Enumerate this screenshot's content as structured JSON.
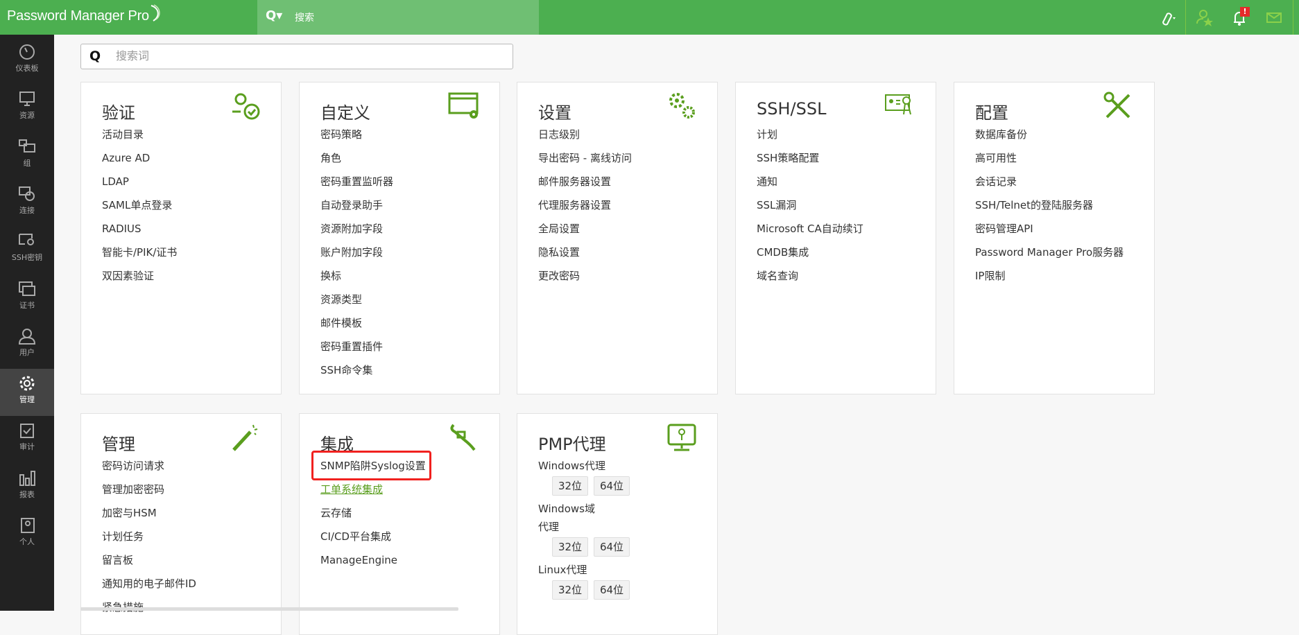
{
  "app": {
    "logo": "Password Manager Pro",
    "global_search": "搜索"
  },
  "colors": {
    "brand": "#4caf50",
    "accent": "#5a9e1e",
    "highlight": "#f0211f"
  },
  "topbar": {
    "badge": "!"
  },
  "sidebar": [
    {
      "label": "仪表板",
      "icon": "dashboard-icon"
    },
    {
      "label": "资源",
      "icon": "monitor-icon"
    },
    {
      "label": "组",
      "icon": "group-icon"
    },
    {
      "label": "连接",
      "icon": "connection-icon"
    },
    {
      "label": "SSH密钥",
      "icon": "ssh-key-icon"
    },
    {
      "label": "证书",
      "icon": "certificate-icon"
    },
    {
      "label": "用户",
      "icon": "user-icon"
    },
    {
      "label": "管理",
      "icon": "gear-icon",
      "active": true
    },
    {
      "label": "审计",
      "icon": "audit-icon"
    },
    {
      "label": "报表",
      "icon": "report-icon"
    },
    {
      "label": "个人",
      "icon": "personal-icon"
    }
  ],
  "search": {
    "placeholder": "搜索词",
    "value": ""
  },
  "cards": [
    {
      "title": "验证",
      "items": [
        "活动目录",
        "Azure AD",
        "LDAP",
        "SAML单点登录",
        "RADIUS",
        "智能卡/PIK/证书",
        "双因素验证"
      ]
    },
    {
      "title": "自定义",
      "items": [
        "密码策略",
        "角色",
        "密码重置监听器",
        "自动登录助手",
        "资源附加字段",
        "账户附加字段",
        "换标",
        "资源类型",
        "邮件模板",
        "密码重置插件",
        "SSH命令集"
      ]
    },
    {
      "title": "设置",
      "items": [
        "日志级别",
        "导出密码 - 离线访问",
        "邮件服务器设置",
        "代理服务器设置",
        "全局设置",
        "隐私设置",
        "更改密码"
      ]
    },
    {
      "title": "SSH/SSL",
      "items": [
        "计划",
        "SSH策略配置",
        "通知",
        "SSL漏洞",
        "Microsoft CA自动续订",
        "CMDB集成",
        "域名查询"
      ]
    },
    {
      "title": "配置",
      "items": [
        "数据库备份",
        "高可用性",
        "会话记录",
        "SSH/Telnet的登陆服务器",
        "密码管理API",
        "Password Manager Pro服务器",
        "IP限制"
      ]
    },
    {
      "title": "管理",
      "items": [
        "密码访问请求",
        "管理加密密码",
        "加密与HSM",
        "计划任务",
        "留言板",
        "通知用的电子邮件ID",
        "紧急措施"
      ]
    },
    {
      "title": "集成",
      "items": [
        "SNMP陷阱Syslog设置",
        "工单系统集成",
        "云存储",
        "CI/CD平台集成",
        "ManageEngine"
      ]
    },
    {
      "title": "PMP代理",
      "agents": [
        {
          "label": "Windows代理",
          "b32": "32位",
          "b64": "64位"
        },
        {
          "label": "Windows域代理",
          "b32": "32位",
          "b64": "64位"
        },
        {
          "label": "Linux代理",
          "b32": "32位",
          "b64": "64位"
        }
      ]
    }
  ]
}
